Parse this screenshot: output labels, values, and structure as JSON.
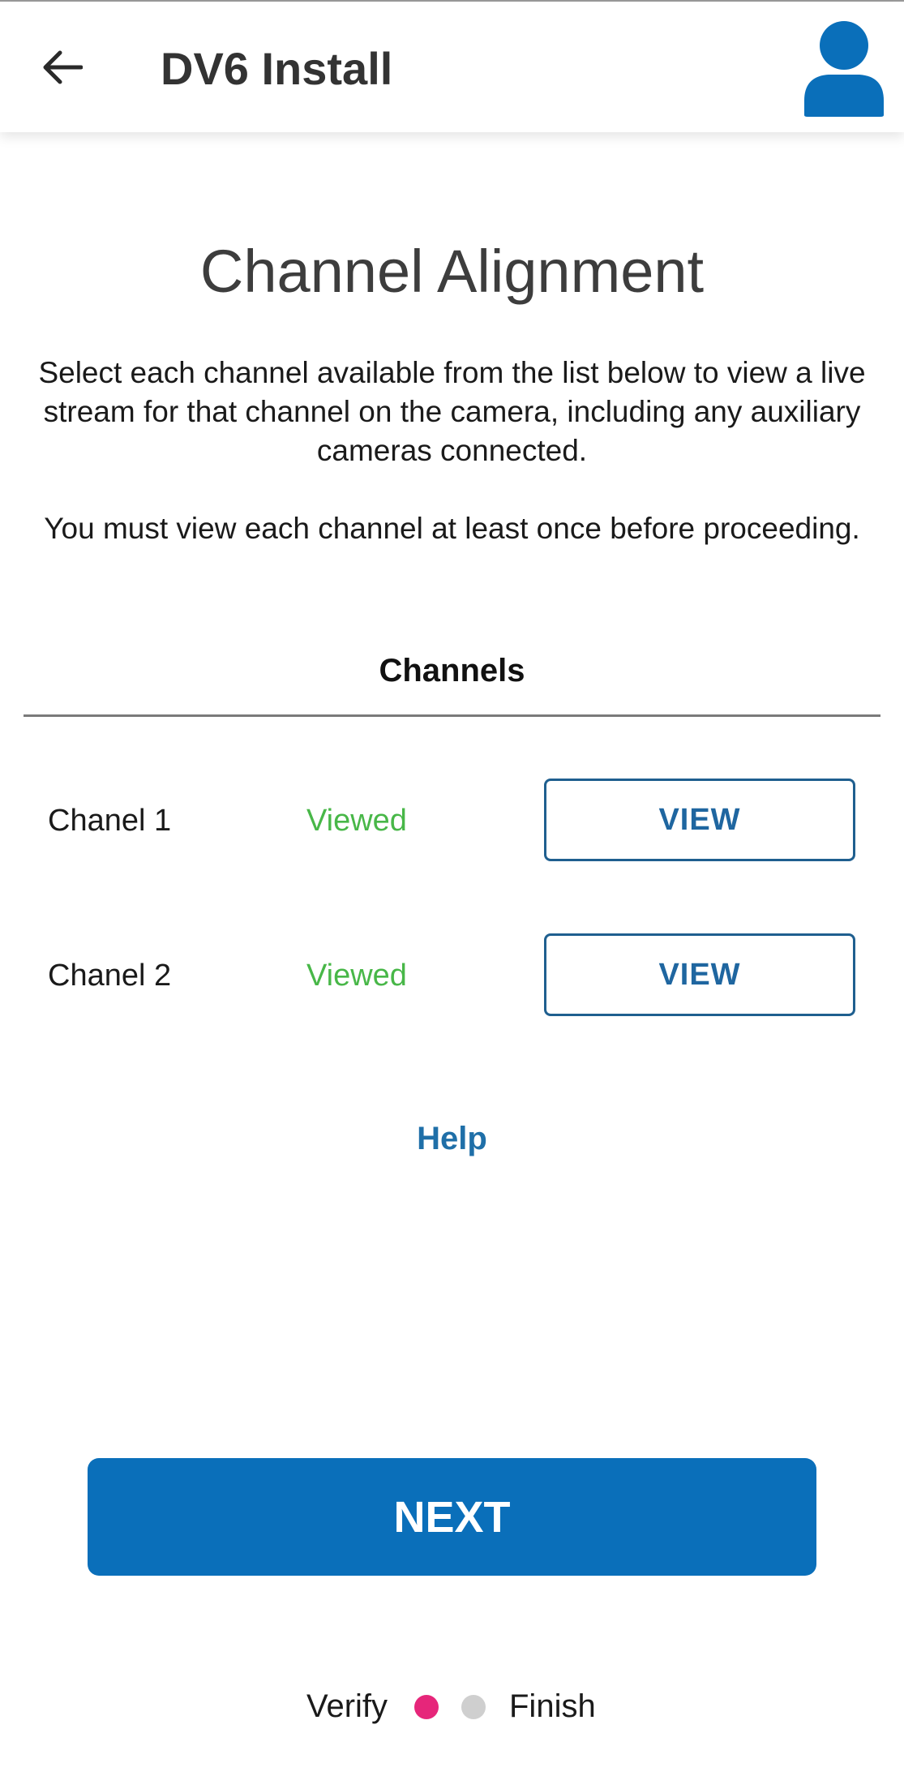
{
  "app_bar": {
    "title": "DV6 Install",
    "back_icon": "arrow-left-icon",
    "avatar_icon": "user-icon",
    "accent_color": "#0a6fba"
  },
  "page": {
    "title": "Channel Alignment",
    "description_1": "Select each channel available from the list below to view a live stream for that channel on the camera, including any auxiliary cameras connected.",
    "description_2": "You must view each channel at least once before proceeding."
  },
  "channels": {
    "heading": "Channels",
    "items": [
      {
        "name": "Chanel 1",
        "status": "Viewed",
        "button_label": "VIEW"
      },
      {
        "name": "Chanel 2",
        "status": "Viewed",
        "button_label": "VIEW"
      }
    ],
    "status_color": "#48b748"
  },
  "help": {
    "label": "Help"
  },
  "next": {
    "label": "NEXT"
  },
  "stepper": {
    "start_label": "Verify",
    "end_label": "Finish",
    "active_color": "#e6267a",
    "inactive_color": "#cfcfcf"
  }
}
